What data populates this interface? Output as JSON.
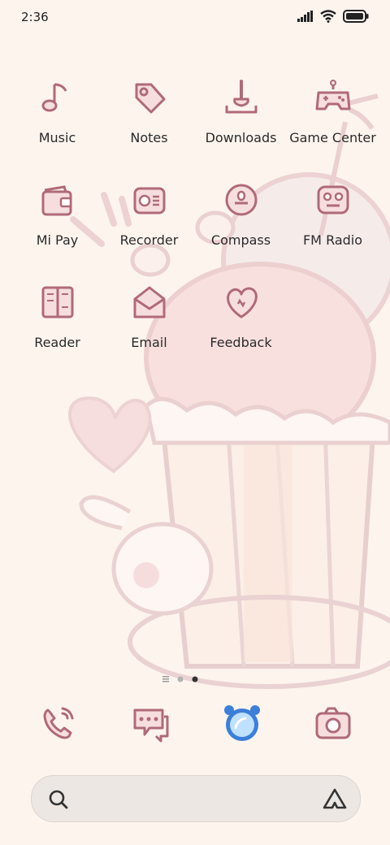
{
  "status_bar": {
    "time": "2:36"
  },
  "apps": [
    {
      "label": "Music",
      "icon": "music-note-icon"
    },
    {
      "label": "Notes",
      "icon": "tag-icon"
    },
    {
      "label": "Downloads",
      "icon": "download-icon"
    },
    {
      "label": "Game Center",
      "icon": "gamepad-icon"
    },
    {
      "label": "Mi Pay",
      "icon": "wallet-icon"
    },
    {
      "label": "Recorder",
      "icon": "recorder-icon"
    },
    {
      "label": "Compass",
      "icon": "compass-icon"
    },
    {
      "label": "FM Radio",
      "icon": "radio-icon"
    },
    {
      "label": "Reader",
      "icon": "book-icon"
    },
    {
      "label": "Email",
      "icon": "envelope-icon"
    },
    {
      "label": "Feedback",
      "icon": "heart-chat-icon"
    }
  ],
  "pager": {
    "pages": 3,
    "active": 2
  },
  "dock": [
    "phone-icon",
    "messages-icon",
    "browser-icon",
    "camera-icon"
  ],
  "search": {
    "icon": "search-icon",
    "assistant_icon": "assistant-icon"
  },
  "colors": {
    "icon_stroke": "#b06a78",
    "icon_fill": "#f6dede",
    "background": "#fdf4ee"
  }
}
